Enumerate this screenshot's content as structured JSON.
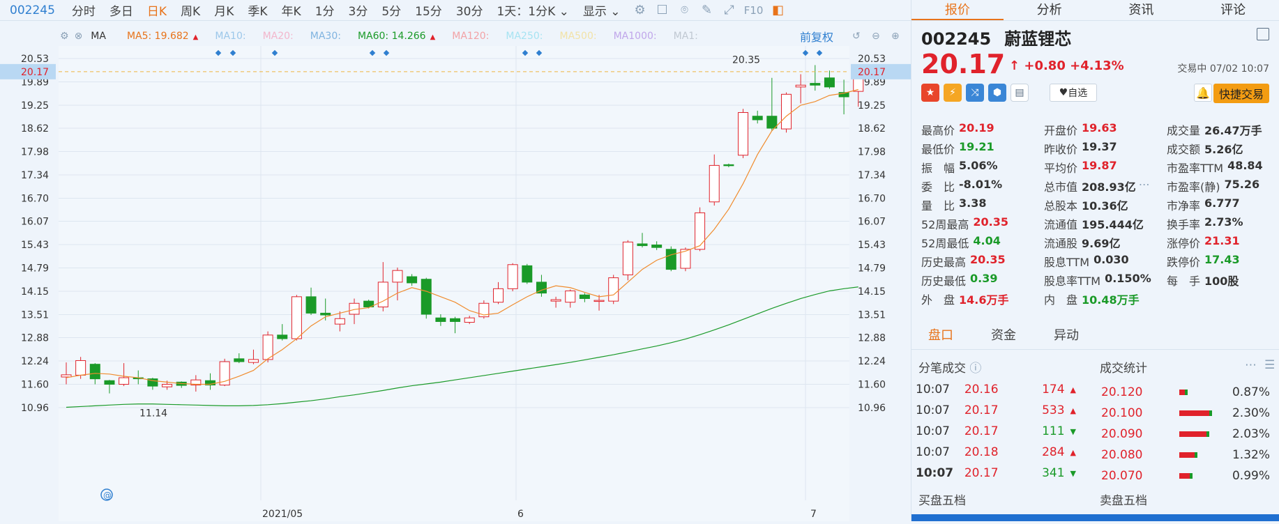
{
  "toolbar": {
    "code": "002245",
    "periods": [
      "分时",
      "多日",
      "日K",
      "周K",
      "月K",
      "季K",
      "年K",
      "1分",
      "3分",
      "5分",
      "15分",
      "30分",
      "1天：1分K"
    ],
    "active_period": "日K",
    "display_label": "显示",
    "f10_label": "F10"
  },
  "ma_bar": {
    "label": "MA",
    "items": [
      {
        "label": "MA5:",
        "value": "19.682",
        "color": "#e8731a"
      },
      {
        "label": "MA10:",
        "value": "",
        "color": "#9cc7ea"
      },
      {
        "label": "MA20:",
        "value": "",
        "color": "#f2b6cc"
      },
      {
        "label": "MA30:",
        "value": "",
        "color": "#7fb3e0"
      },
      {
        "label": "MA60:",
        "value": "14.266",
        "color": "#1a9a28"
      },
      {
        "label": "MA120:",
        "value": "",
        "color": "#f2a2a6"
      },
      {
        "label": "MA250:",
        "value": "",
        "color": "#a6e3f2"
      },
      {
        "label": "MA500:",
        "value": "",
        "color": "#f2e2a6"
      },
      {
        "label": "MA1000:",
        "value": "",
        "color": "#c0a6ea"
      },
      {
        "label": "MA1:",
        "value": "",
        "color": "#c0c8d2"
      }
    ],
    "adjust_label": "前复权"
  },
  "chart_data": {
    "type": "candlestick",
    "y_ticks": [
      "20.53",
      "19.89",
      "19.25",
      "18.62",
      "17.98",
      "17.34",
      "16.70",
      "16.07",
      "15.43",
      "14.79",
      "14.15",
      "13.51",
      "12.88",
      "12.24",
      "11.60",
      "10.96"
    ],
    "current_price_label": "20.17",
    "x_labels": [
      "2021/05",
      "6",
      "7"
    ],
    "max_label": "20.35",
    "min_label": "11.14",
    "candles": [
      {
        "o": 11.8,
        "h": 12.2,
        "l": 11.6,
        "c": 11.86
      },
      {
        "o": 11.85,
        "h": 12.35,
        "l": 11.75,
        "c": 12.25
      },
      {
        "o": 12.15,
        "h": 12.18,
        "l": 11.6,
        "c": 11.75
      },
      {
        "o": 11.7,
        "h": 11.72,
        "l": 11.35,
        "c": 11.6
      },
      {
        "o": 11.6,
        "h": 12.18,
        "l": 11.55,
        "c": 11.78
      },
      {
        "o": 11.78,
        "h": 11.98,
        "l": 11.6,
        "c": 11.76
      },
      {
        "o": 11.75,
        "h": 11.78,
        "l": 11.45,
        "c": 11.55
      },
      {
        "o": 11.53,
        "h": 11.7,
        "l": 11.45,
        "c": 11.6
      },
      {
        "o": 11.66,
        "h": 11.68,
        "l": 11.5,
        "c": 11.57
      },
      {
        "o": 11.58,
        "h": 11.85,
        "l": 11.4,
        "c": 11.72
      },
      {
        "o": 11.7,
        "h": 11.9,
        "l": 11.45,
        "c": 11.58
      },
      {
        "o": 11.58,
        "h": 12.3,
        "l": 11.55,
        "c": 12.22
      },
      {
        "o": 12.3,
        "h": 12.45,
        "l": 12.18,
        "c": 12.22
      },
      {
        "o": 12.2,
        "h": 12.55,
        "l": 12.15,
        "c": 12.28
      },
      {
        "o": 12.28,
        "h": 13.05,
        "l": 12.2,
        "c": 12.95
      },
      {
        "o": 12.95,
        "h": 13.25,
        "l": 12.8,
        "c": 12.85
      },
      {
        "o": 12.85,
        "h": 14.05,
        "l": 12.8,
        "c": 14.0
      },
      {
        "o": 14.0,
        "h": 14.25,
        "l": 13.5,
        "c": 13.55
      },
      {
        "o": 13.55,
        "h": 13.95,
        "l": 13.35,
        "c": 13.5
      },
      {
        "o": 13.25,
        "h": 13.6,
        "l": 13.05,
        "c": 13.4
      },
      {
        "o": 13.52,
        "h": 13.95,
        "l": 13.25,
        "c": 13.82
      },
      {
        "o": 13.88,
        "h": 13.92,
        "l": 13.68,
        "c": 13.72
      },
      {
        "o": 13.72,
        "h": 14.95,
        "l": 13.6,
        "c": 14.4
      },
      {
        "o": 14.4,
        "h": 14.8,
        "l": 13.9,
        "c": 14.72
      },
      {
        "o": 14.55,
        "h": 14.62,
        "l": 14.3,
        "c": 14.38
      },
      {
        "o": 14.48,
        "h": 14.52,
        "l": 13.4,
        "c": 13.52
      },
      {
        "o": 13.42,
        "h": 13.52,
        "l": 13.2,
        "c": 13.32
      },
      {
        "o": 13.4,
        "h": 13.45,
        "l": 13.0,
        "c": 13.32
      },
      {
        "o": 13.3,
        "h": 13.48,
        "l": 13.25,
        "c": 13.42
      },
      {
        "o": 13.45,
        "h": 13.9,
        "l": 13.4,
        "c": 13.82
      },
      {
        "o": 13.85,
        "h": 14.4,
        "l": 13.8,
        "c": 14.22
      },
      {
        "o": 14.22,
        "h": 14.92,
        "l": 14.15,
        "c": 14.88
      },
      {
        "o": 14.85,
        "h": 14.9,
        "l": 14.35,
        "c": 14.4
      },
      {
        "o": 14.4,
        "h": 14.6,
        "l": 14.0,
        "c": 14.1
      },
      {
        "o": 13.88,
        "h": 14.0,
        "l": 13.7,
        "c": 13.92
      },
      {
        "o": 13.85,
        "h": 14.2,
        "l": 13.7,
        "c": 14.16
      },
      {
        "o": 14.05,
        "h": 14.1,
        "l": 13.85,
        "c": 13.95
      },
      {
        "o": 13.88,
        "h": 14.05,
        "l": 13.62,
        "c": 13.9
      },
      {
        "o": 13.88,
        "h": 14.6,
        "l": 13.8,
        "c": 14.52
      },
      {
        "o": 14.6,
        "h": 15.55,
        "l": 14.45,
        "c": 15.5
      },
      {
        "o": 15.45,
        "h": 15.75,
        "l": 15.35,
        "c": 15.4
      },
      {
        "o": 15.42,
        "h": 15.52,
        "l": 15.28,
        "c": 15.35
      },
      {
        "o": 15.3,
        "h": 15.38,
        "l": 14.7,
        "c": 14.75
      },
      {
        "o": 14.78,
        "h": 15.35,
        "l": 14.7,
        "c": 15.3
      },
      {
        "o": 15.3,
        "h": 16.45,
        "l": 15.25,
        "c": 16.3
      },
      {
        "o": 16.6,
        "h": 17.9,
        "l": 16.5,
        "c": 17.6
      },
      {
        "o": 17.62,
        "h": 17.65,
        "l": 17.55,
        "c": 17.6
      },
      {
        "o": 17.88,
        "h": 19.15,
        "l": 17.8,
        "c": 19.05
      },
      {
        "o": 18.95,
        "h": 19.1,
        "l": 18.75,
        "c": 18.85
      },
      {
        "o": 18.95,
        "h": 20.0,
        "l": 18.55,
        "c": 18.62
      },
      {
        "o": 18.6,
        "h": 19.6,
        "l": 18.5,
        "c": 19.55
      },
      {
        "o": 19.75,
        "h": 20.1,
        "l": 19.3,
        "c": 19.8
      },
      {
        "o": 19.85,
        "h": 20.35,
        "l": 19.65,
        "c": 19.8
      },
      {
        "o": 20.0,
        "h": 20.2,
        "l": 19.7,
        "c": 19.75
      },
      {
        "o": 19.6,
        "h": 19.95,
        "l": 19.0,
        "c": 19.48
      },
      {
        "o": 19.63,
        "h": 20.19,
        "l": 19.21,
        "c": 20.17
      }
    ],
    "ma5": [
      11.78,
      11.85,
      11.9,
      11.88,
      11.82,
      11.78,
      11.7,
      11.66,
      11.62,
      11.6,
      11.6,
      11.68,
      11.82,
      11.98,
      12.3,
      12.55,
      12.85,
      13.2,
      13.45,
      13.55,
      13.65,
      13.7,
      13.88,
      14.1,
      14.25,
      14.15,
      14.0,
      13.85,
      13.62,
      13.5,
      13.55,
      13.78,
      14.0,
      14.18,
      14.3,
      14.25,
      14.12,
      14.0,
      14.05,
      14.4,
      14.75,
      15.0,
      15.15,
      15.25,
      15.4,
      15.85,
      16.4,
      17.1,
      17.9,
      18.55,
      18.95,
      19.25,
      19.35,
      19.52,
      19.58,
      19.68
    ],
    "ma60": [
      10.97,
      10.99,
      11.01,
      11.03,
      11.05,
      11.06,
      11.06,
      11.05,
      11.04,
      11.03,
      11.02,
      11.01,
      11.01,
      11.02,
      11.04,
      11.07,
      11.11,
      11.15,
      11.2,
      11.26,
      11.31,
      11.37,
      11.43,
      11.5,
      11.56,
      11.61,
      11.66,
      11.72,
      11.78,
      11.84,
      11.9,
      11.96,
      12.02,
      12.08,
      12.14,
      12.2,
      12.27,
      12.34,
      12.41,
      12.49,
      12.57,
      12.65,
      12.74,
      12.84,
      12.96,
      13.09,
      13.23,
      13.38,
      13.53,
      13.68,
      13.82,
      13.95,
      14.06,
      14.16,
      14.22,
      14.27
    ],
    "y_min": 10.96,
    "y_max": 20.53
  },
  "right_tabs": [
    "报价",
    "分析",
    "资讯",
    "评论"
  ],
  "stock": {
    "code": "002245",
    "name": "蔚蓝锂芯",
    "price": "20.17",
    "change": "+0.80",
    "change_pct": "+4.13%",
    "status": "交易中 07/02 10:07",
    "fav_label": "自选",
    "quick_trade_label": "快捷交易"
  },
  "quote_rows": [
    [
      {
        "l": "最高价",
        "v": "20.19",
        "c": "red"
      },
      {
        "l": "开盘价",
        "v": "19.63",
        "c": "red"
      },
      {
        "l": "成交量",
        "v": "26.47万手",
        "c": ""
      }
    ],
    [
      {
        "l": "最低价",
        "v": "19.21",
        "c": "green"
      },
      {
        "l": "昨收价",
        "v": "19.37",
        "c": ""
      },
      {
        "l": "成交额",
        "v": "5.26亿",
        "c": ""
      }
    ],
    [
      {
        "l": "振　幅",
        "v": "5.06%",
        "c": ""
      },
      {
        "l": "平均价",
        "v": "19.87",
        "c": "red"
      },
      {
        "l": "市盈率TTM",
        "v": "48.84",
        "c": ""
      }
    ],
    [
      {
        "l": "委　比",
        "v": "-8.01%",
        "c": ""
      },
      {
        "l": "总市值",
        "v": "208.93亿",
        "c": ""
      },
      {
        "l": "市盈率(静)",
        "v": "75.26",
        "c": ""
      }
    ],
    [
      {
        "l": "量　比",
        "v": "3.38",
        "c": ""
      },
      {
        "l": "总股本",
        "v": "10.36亿",
        "c": ""
      },
      {
        "l": "市净率",
        "v": "6.777",
        "c": ""
      }
    ],
    [
      {
        "l": "52周最高",
        "v": "20.35",
        "c": "red"
      },
      {
        "l": "流通值",
        "v": "195.444亿",
        "c": ""
      },
      {
        "l": "换手率",
        "v": "2.73%",
        "c": ""
      }
    ],
    [
      {
        "l": "52周最低",
        "v": "4.04",
        "c": "green"
      },
      {
        "l": "流通股",
        "v": "9.69亿",
        "c": ""
      },
      {
        "l": "涨停价",
        "v": "21.31",
        "c": "red"
      }
    ],
    [
      {
        "l": "历史最高",
        "v": "20.35",
        "c": "red"
      },
      {
        "l": "股息TTM",
        "v": "0.030",
        "c": ""
      },
      {
        "l": "跌停价",
        "v": "17.43",
        "c": "green"
      }
    ],
    [
      {
        "l": "历史最低",
        "v": "0.39",
        "c": "green"
      },
      {
        "l": "股息率TTM",
        "v": "0.150%",
        "c": ""
      },
      {
        "l": "每　手",
        "v": "100股",
        "c": ""
      }
    ],
    [
      {
        "l": "外　盘",
        "v": "14.6万手",
        "c": "red"
      },
      {
        "l": "内　盘",
        "v": "10.48万手",
        "c": "green"
      },
      {
        "l": "",
        "v": "",
        "c": ""
      }
    ]
  ],
  "sub_tabs": [
    "盘口",
    "资金",
    "异动"
  ],
  "ticks_title": "分笔成交",
  "stats_title": "成交统计",
  "ticks": [
    {
      "time": "10:07",
      "price": "20.16",
      "vol": "174",
      "dir": "up"
    },
    {
      "time": "10:07",
      "price": "20.17",
      "vol": "533",
      "dir": "up"
    },
    {
      "time": "10:07",
      "price": "20.17",
      "vol": "111",
      "dir": "down"
    },
    {
      "time": "10:07",
      "price": "20.18",
      "vol": "284",
      "dir": "up"
    },
    {
      "time": "10:07",
      "price": "20.17",
      "vol": "341",
      "dir": "down"
    }
  ],
  "stats": [
    {
      "price": "20.120",
      "pct": "0.87%",
      "frac": 0.12
    },
    {
      "price": "20.100",
      "pct": "2.30%",
      "frac": 0.62
    },
    {
      "price": "20.090",
      "pct": "2.03%",
      "frac": 0.55
    },
    {
      "price": "20.080",
      "pct": "1.32%",
      "frac": 0.32
    },
    {
      "price": "20.070",
      "pct": "0.99%",
      "frac": 0.22
    }
  ],
  "orderbook": {
    "buy_label": "买盘五档",
    "sell_label": "卖盘五档"
  }
}
